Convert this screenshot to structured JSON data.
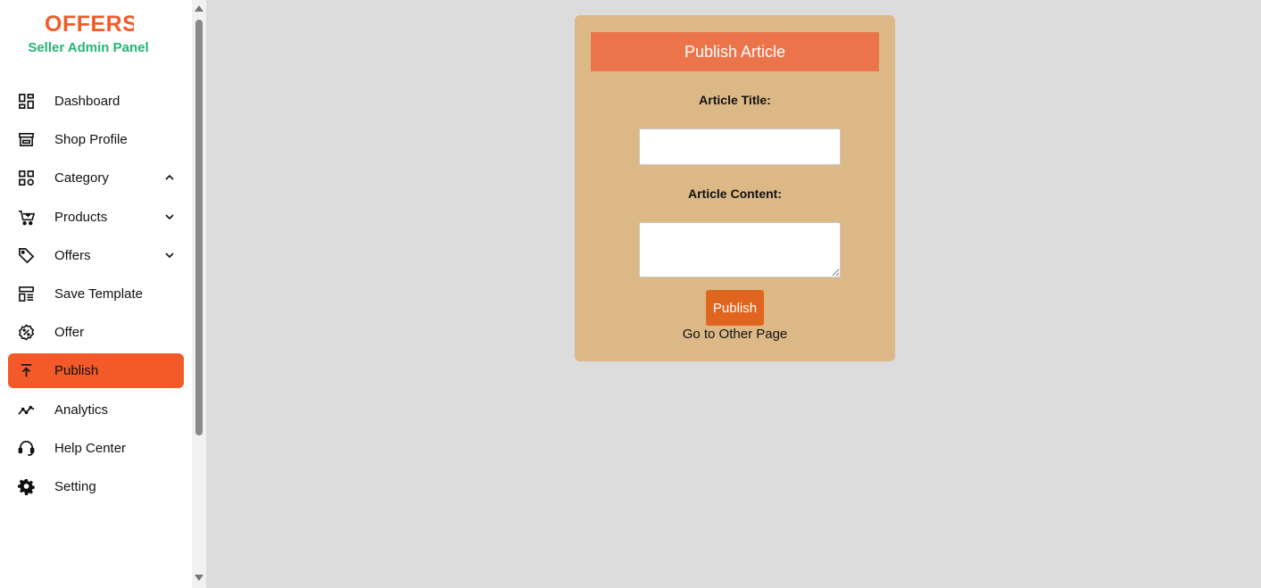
{
  "brand": {
    "logo_text": "OFFERS",
    "subtitle": "Seller Admin Panel",
    "accent_color": "#f25a29",
    "subtitle_color": "#22b573"
  },
  "sidebar": {
    "items": [
      {
        "label": "Dashboard",
        "icon": "dashboard-icon"
      },
      {
        "label": "Shop Profile",
        "icon": "store-icon"
      },
      {
        "label": "Category",
        "icon": "category-icon",
        "expanded": true
      },
      {
        "label": "Products",
        "icon": "cart-icon",
        "expanded": false
      },
      {
        "label": "Offers",
        "icon": "tag-icon",
        "expanded": false
      },
      {
        "label": "Save Template",
        "icon": "template-icon"
      },
      {
        "label": "Offer",
        "icon": "discount-icon"
      },
      {
        "label": "Publish",
        "icon": "publish-icon",
        "active": true
      },
      {
        "label": "Analytics",
        "icon": "analytics-icon"
      },
      {
        "label": "Help Center",
        "icon": "headset-icon"
      },
      {
        "label": "Setting",
        "icon": "gear-icon"
      }
    ]
  },
  "form": {
    "header": "Publish Article",
    "title_label": "Article Title:",
    "title_value": "",
    "content_label": "Article Content:",
    "content_value": "",
    "publish_label": "Publish",
    "other_page_link": "Go to Other Page",
    "card_color": "#ddb887",
    "header_color": "#ec744b",
    "button_color": "#e0661f"
  }
}
